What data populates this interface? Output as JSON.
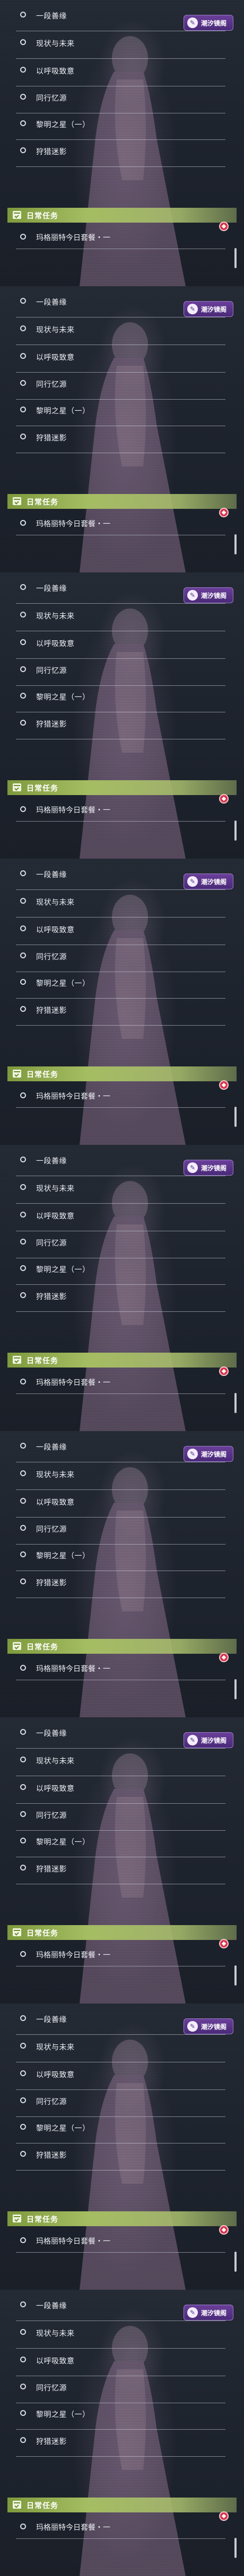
{
  "badge": {
    "text": "潮汐镜阁",
    "icon": "scroll-quill-icon"
  },
  "quests": [
    "一段善缘",
    "现状与未来",
    "以呼吸致意",
    "同行忆源",
    "黎明之星（一）",
    "狩猎迷影"
  ],
  "daily": {
    "title": "日常任务",
    "icon": "calendar-check-icon",
    "task": "玛格丽特今日套餐・一"
  },
  "colors": {
    "accent_green": "#a5bd62",
    "badge_purple": "#5c3590",
    "alert_red": "#d8344b"
  },
  "repeat_count": 9
}
